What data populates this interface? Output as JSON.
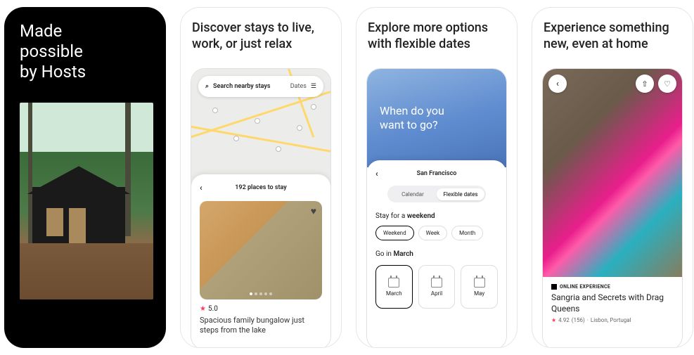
{
  "card1": {
    "title_line1": "Made",
    "title_line2": "possible",
    "title_line3": "by Hosts"
  },
  "card2": {
    "heading": "Discover stays to live, work, or just relax",
    "search_placeholder": "Search nearby stays",
    "search_dates_label": "Dates",
    "places_count_label": "192 places to stay",
    "listing": {
      "rating": "5.0",
      "title": "Spacious family bungalow just steps from the lake"
    }
  },
  "card3": {
    "heading": "Explore more options with flexible dates",
    "hero_line1": "When do you",
    "hero_line2": "want to go?",
    "location": "San Francisco",
    "tabs": {
      "calendar": "Calendar",
      "flexible": "Flexible dates"
    },
    "stay_label_prefix": "Stay for a ",
    "stay_label_bold": "weekend",
    "length_options": [
      "Weekend",
      "Week",
      "Month"
    ],
    "go_label_prefix": "Go in ",
    "go_label_bold": "March",
    "months": [
      "March",
      "April",
      "May"
    ]
  },
  "card4": {
    "heading": "Experience something new, even at home",
    "badge": "ONLINE EXPERIENCE",
    "title": "Sangria and Secrets with Drag Queens",
    "rating": "4.92",
    "review_count": "(156)",
    "location": "Lisbon, Portugal"
  }
}
